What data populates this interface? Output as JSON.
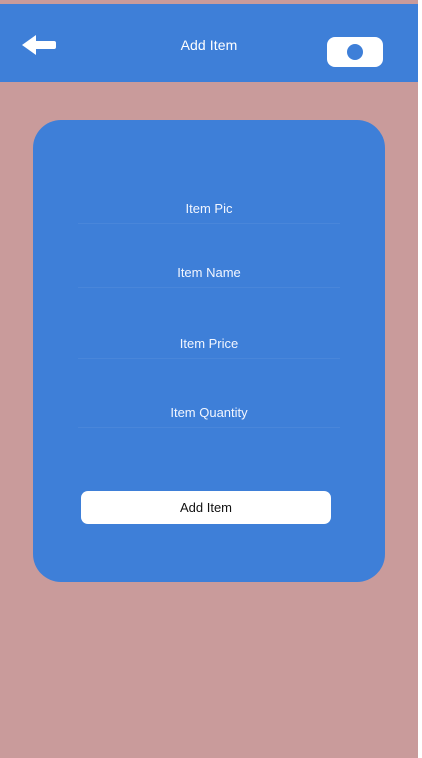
{
  "header": {
    "title": "Add Item",
    "back_icon": "arrow-left-icon",
    "camera_icon": "camera-icon"
  },
  "form": {
    "fields": [
      {
        "label": "Item Pic"
      },
      {
        "label": "Item Name"
      },
      {
        "label": "Item Price"
      },
      {
        "label": "Item Quantity"
      }
    ],
    "submit_label": "Add Item"
  },
  "colors": {
    "primary": "#3e7fd8",
    "background": "#c99b9b",
    "button": "#ffffff",
    "text_light": "#ffffff",
    "text_dark": "#111111"
  }
}
